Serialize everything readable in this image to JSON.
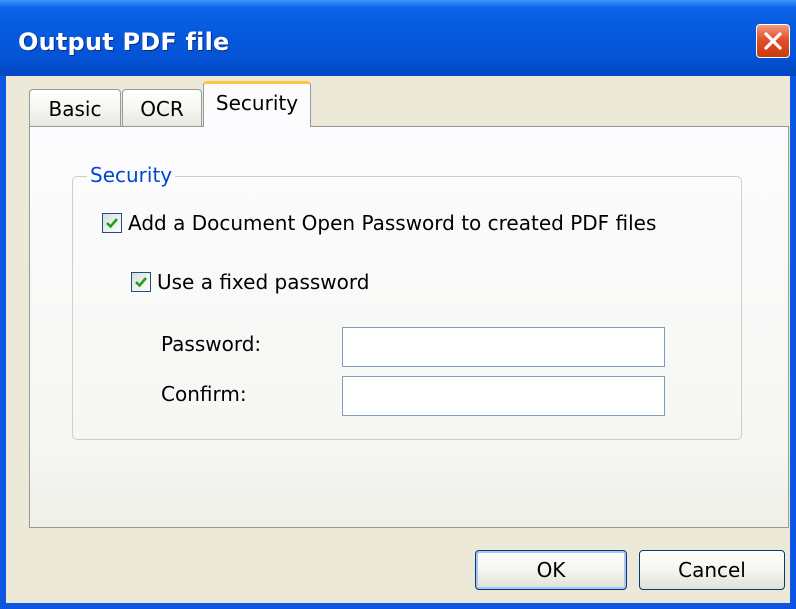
{
  "window": {
    "title": "Output PDF file"
  },
  "tabs": [
    {
      "label": "Basic",
      "selected": false
    },
    {
      "label": "OCR",
      "selected": false
    },
    {
      "label": "Security",
      "selected": true
    }
  ],
  "security": {
    "group_label": "Security",
    "add_open_password": {
      "label": "Add a Document Open Password to created PDF files",
      "checked": true
    },
    "use_fixed_password": {
      "label": "Use a fixed password",
      "checked": true
    },
    "password": {
      "label": "Password:",
      "value": ""
    },
    "confirm": {
      "label": "Confirm:",
      "value": ""
    }
  },
  "buttons": {
    "ok_label": "OK",
    "cancel_label": "Cancel"
  },
  "colors": {
    "titlebar": "#0553d6",
    "accent_legend": "#0046d5",
    "checkmark": "#21a121",
    "close_button": "#e2502a",
    "selected_tab_highlight": "#ffc83c"
  }
}
